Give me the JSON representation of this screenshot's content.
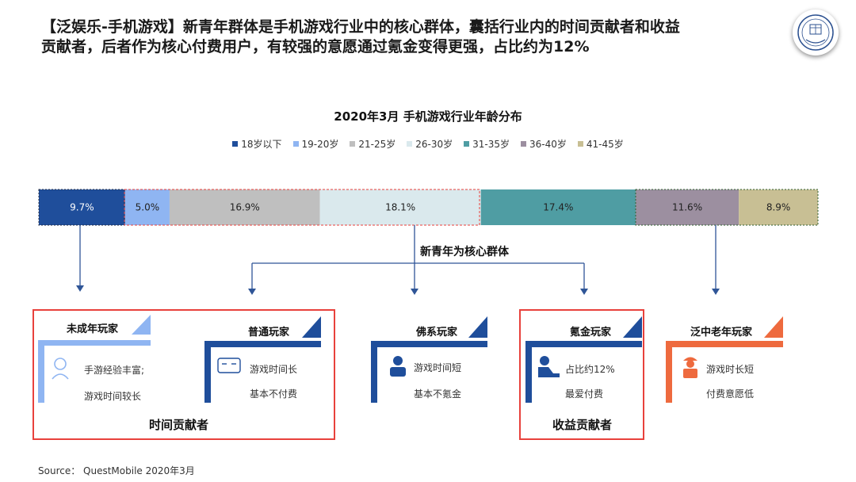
{
  "headline": "【泛娱乐-手机游戏】新青年群体是手机游戏行业中的核心群体，囊括行业内的时间贡献者和收益贡献者，后者作为核心付费用户，有较强的意愿通过氪金变得更强，占比约为12%",
  "logo": {
    "icon": "university-seal-logo",
    "text": "北京师范大学"
  },
  "chart_data": {
    "type": "bar",
    "title": "2020年3月 手机游戏行业年龄分布",
    "orientation": "horizontal-stacked",
    "legend_position": "top",
    "series": [
      {
        "name": "18岁以下",
        "value": 9.7,
        "label": "9.7%",
        "color": "#1f4e9b"
      },
      {
        "name": "19-20岁",
        "value": 5.0,
        "label": "5.0%",
        "color": "#8fb5f2"
      },
      {
        "name": "21-25岁",
        "value": 16.9,
        "label": "16.9%",
        "color": "#bfbfbf"
      },
      {
        "name": "26-30岁",
        "value": 18.1,
        "label": "18.1%",
        "color": "#dae9ed"
      },
      {
        "name": "31-35岁",
        "value": 17.4,
        "label": "17.4%",
        "color": "#4f9da3"
      },
      {
        "name": "36-40岁",
        "value": 11.6,
        "label": "11.6%",
        "color": "#9c8fa0"
      },
      {
        "name": "41-45岁",
        "value": 8.9,
        "label": "8.9%",
        "color": "#c8bf94"
      }
    ]
  },
  "core_group_label": "新青年为核心群体",
  "cards": [
    {
      "title": "未成年玩家",
      "lines": [
        "手游经验丰富;",
        "游戏时间较长"
      ],
      "color": "#8fb5f2",
      "icon": "child-icon"
    },
    {
      "title": "普通玩家",
      "lines": [
        "游戏时间长",
        "基本不付费"
      ],
      "color": "#1f4e9b",
      "icon": "headset-player-icon"
    },
    {
      "title": "佛系玩家",
      "lines": [
        "游戏时间短",
        "基本不氪金"
      ],
      "color": "#1f4e9b",
      "icon": "person-icon"
    },
    {
      "title": "氪金玩家",
      "lines": [
        "占比约12%",
        "最爱付费"
      ],
      "color": "#1f4e9b",
      "icon": "gamer-icon"
    },
    {
      "title": "泛中老年玩家",
      "lines": [
        "游戏时长短",
        "付费意愿低"
      ],
      "color": "#ee6a3e",
      "icon": "elder-icon"
    }
  ],
  "groups": {
    "time": "时间贡献者",
    "revenue": "收益贡献者"
  },
  "source": "Source： QuestMobile 2020年3月"
}
